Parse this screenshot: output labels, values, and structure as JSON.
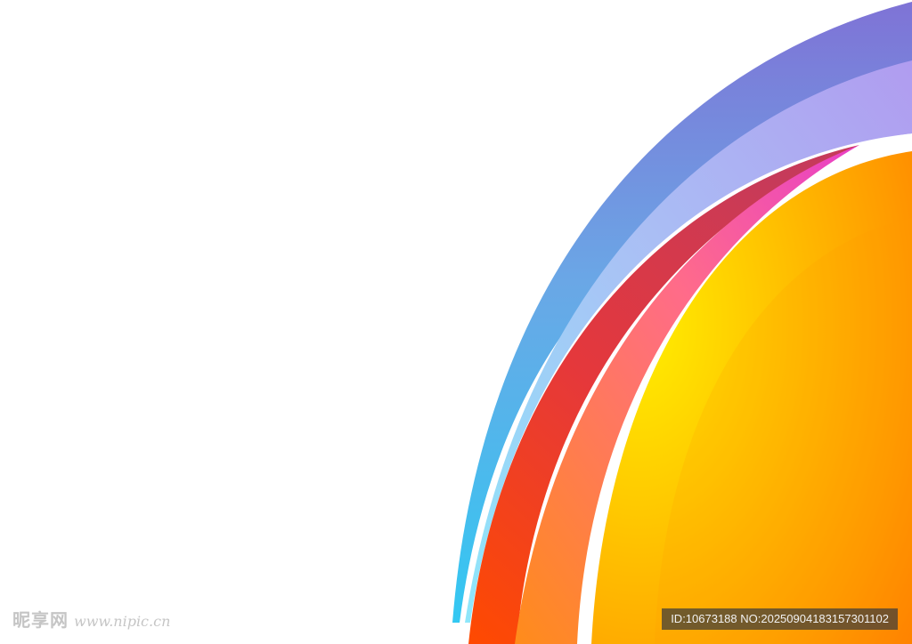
{
  "artwork": {
    "arcs": [
      {
        "name": "purple-blue-arc",
        "colors": [
          "#7f73d6",
          "#6aa7e6",
          "#5bd2ef"
        ]
      },
      {
        "name": "light-blue-arc",
        "colors": [
          "#b09cf0",
          "#a9c2f5",
          "#8ee7fa"
        ]
      },
      {
        "name": "red-arc",
        "colors": [
          "#c63a5a",
          "#e5383b",
          "#ff4a00"
        ]
      },
      {
        "name": "pink-orange-arc",
        "colors": [
          "#e83fc8",
          "#ff6b8a",
          "#ff8c1a"
        ]
      },
      {
        "name": "yellow-orange-disc",
        "colors": [
          "#ffe600",
          "#ffb300",
          "#ff7a00"
        ]
      }
    ]
  },
  "watermark": {
    "brand": "昵享网",
    "url": "www.nipic.cn"
  },
  "id_badge": {
    "text": "ID:10673188 NO:20250904183157301102"
  }
}
